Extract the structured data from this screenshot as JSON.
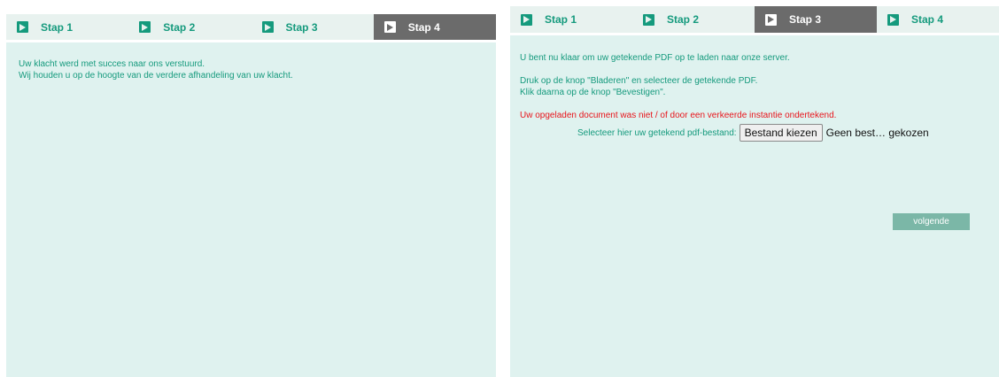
{
  "left_panel": {
    "tabs": [
      {
        "label": "Stap 1",
        "active": false
      },
      {
        "label": "Stap 2",
        "active": false
      },
      {
        "label": "Stap 3",
        "active": false
      },
      {
        "label": "Stap 4",
        "active": true
      }
    ],
    "messages": [
      "Uw klacht werd met succes naar ons verstuurd.",
      "Wij houden u op de hoogte van de verdere afhandeling van uw klacht."
    ]
  },
  "right_panel": {
    "tabs": [
      {
        "label": "Stap 1",
        "active": false
      },
      {
        "label": "Stap 2",
        "active": false
      },
      {
        "label": "Stap 3",
        "active": true
      },
      {
        "label": "Stap 4",
        "active": false
      }
    ],
    "intro": "U bent nu klaar om uw getekende PDF op te laden naar onze server.",
    "instruction_1": "Druk op de knop \"Bladeren\" en selecteer de getekende PDF.",
    "instruction_2": "Klik daarna op de knop \"Bevestigen\".",
    "error": "Uw opgeladen document was niet / of door een verkeerde instantie ondertekend.",
    "file_label": "Selecteer hier uw getekend pdf-bestand:",
    "file_button": "Bestand kiezen",
    "file_status": "Geen best… gekozen",
    "next_button": "volgende"
  },
  "colors": {
    "accent": "#159a7d",
    "content_bg": "#dff2ef",
    "tab_bg": "#e8f2ef",
    "active_tab_bg": "#6b6b6b",
    "error": "#e8141b",
    "button_bg": "#7bb7a7"
  },
  "icons": {
    "tab_icon": "play-square-icon"
  }
}
